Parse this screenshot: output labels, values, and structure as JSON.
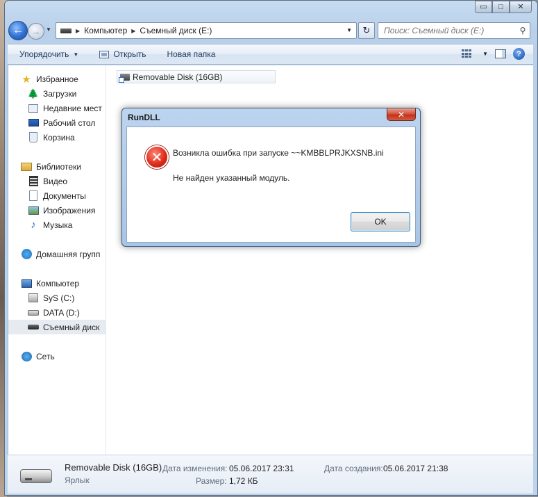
{
  "window": {
    "caption_minimize": "▭",
    "caption_maximize": "□",
    "caption_close": "✕"
  },
  "address": {
    "crumbs": [
      "Компьютер",
      "Съемный диск (E:)"
    ]
  },
  "search": {
    "placeholder": "Поиск: Съемный диск (E:)"
  },
  "toolbar": {
    "organize_label": "Упорядочить",
    "open_label": "Открыть",
    "new_folder_label": "Новая папка"
  },
  "sidebar": {
    "favorites_header": "Избранное",
    "favorites": [
      "Загрузки",
      "Недавние мест",
      "Рабочий стол",
      "Корзина"
    ],
    "libraries_header": "Библиотеки",
    "libraries": [
      "Видео",
      "Документы",
      "Изображения",
      "Музыка"
    ],
    "homegroup": "Домашняя групп",
    "computer_header": "Компьютер",
    "drives": [
      "SyS (C:)",
      "DATA (D:)",
      "Съемный диск"
    ],
    "network": "Сеть"
  },
  "files": [
    {
      "name": "Removable Disk (16GB)"
    }
  ],
  "details": {
    "name": "Removable Disk (16GB)",
    "type": "Ярлык",
    "modified_label": "Дата изменения:",
    "modified_value": "05.06.2017 23:31",
    "created_label": "Дата создания:",
    "created_value": "05.06.2017 21:38",
    "size_label": "Размер:",
    "size_value": "1,72 КБ"
  },
  "dialog": {
    "title": "RunDLL",
    "close_glyph": "✕",
    "message_line1": "Возникла ошибка при запуске ~~KMBBLPRJKXSNB.ini",
    "message_line2": "Не найден указанный модуль.",
    "ok_label": "OK",
    "icon": "error-icon"
  },
  "colors": {
    "window_frame": "#bcd3ec",
    "toolbar_text": "#1e395b",
    "error_red": "#e02d1b",
    "close_red": "#c0331b"
  }
}
